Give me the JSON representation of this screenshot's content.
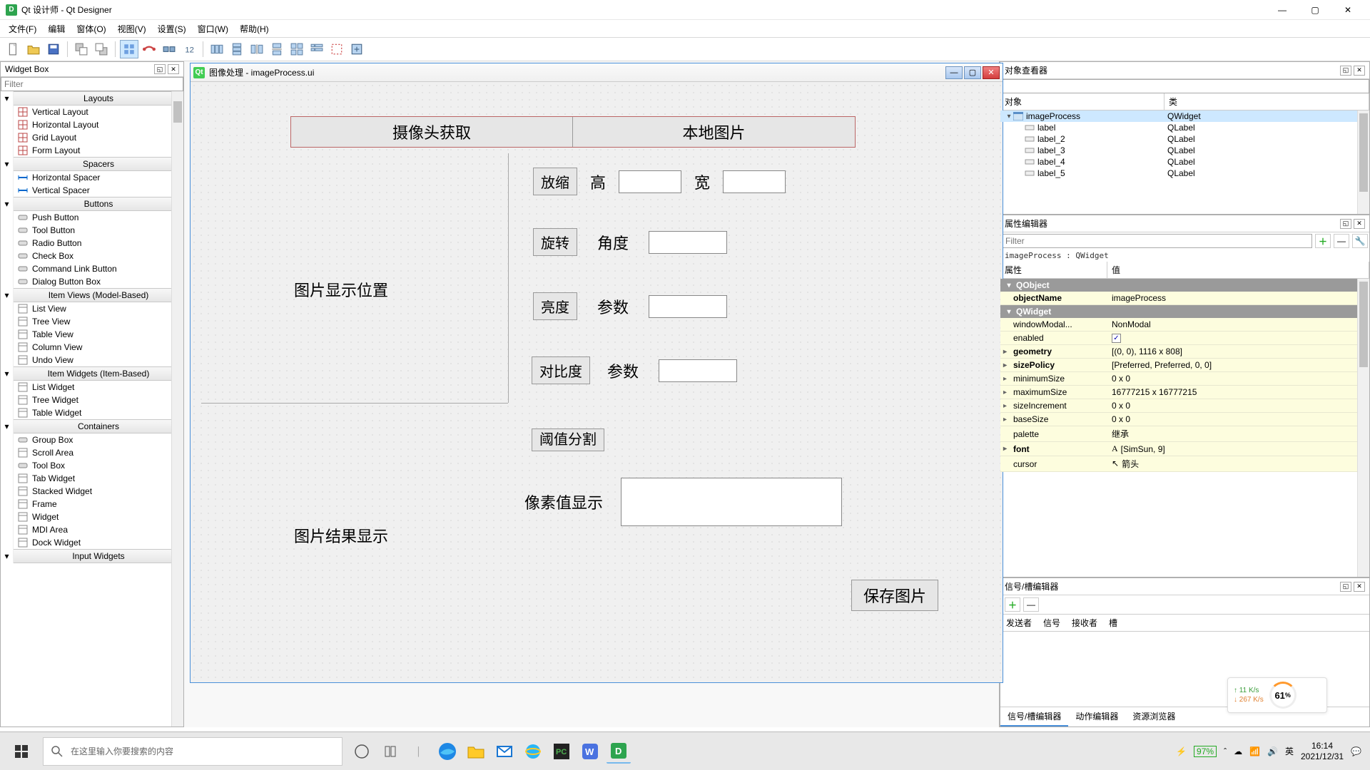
{
  "titlebar": {
    "app_title": "Qt 设计师 - Qt Designer",
    "appicon_letter": "D"
  },
  "menubar": {
    "items": [
      "文件(F)",
      "编辑",
      "窗体(O)",
      "视图(V)",
      "设置(S)",
      "窗口(W)",
      "帮助(H)"
    ]
  },
  "widgetbox": {
    "title": "Widget Box",
    "filter_placeholder": "Filter",
    "categories": [
      {
        "name": "Layouts",
        "items": [
          "Vertical Layout",
          "Horizontal Layout",
          "Grid Layout",
          "Form Layout"
        ]
      },
      {
        "name": "Spacers",
        "items": [
          "Horizontal Spacer",
          "Vertical Spacer"
        ]
      },
      {
        "name": "Buttons",
        "items": [
          "Push Button",
          "Tool Button",
          "Radio Button",
          "Check Box",
          "Command Link Button",
          "Dialog Button Box"
        ]
      },
      {
        "name": "Item Views (Model-Based)",
        "items": [
          "List View",
          "Tree View",
          "Table View",
          "Column View",
          "Undo View"
        ]
      },
      {
        "name": "Item Widgets (Item-Based)",
        "items": [
          "List Widget",
          "Tree Widget",
          "Table Widget"
        ]
      },
      {
        "name": "Containers",
        "items": [
          "Group Box",
          "Scroll Area",
          "Tool Box",
          "Tab Widget",
          "Stacked Widget",
          "Frame",
          "Widget",
          "MDI Area",
          "Dock Widget"
        ]
      },
      {
        "name": "Input Widgets",
        "items": []
      }
    ]
  },
  "designer_window": {
    "title": "图像处理 - imageProcess.ui",
    "tabcam": "摄像头获取",
    "tablocal": "本地图片",
    "img_display": "图片显示位置",
    "img_result": "图片结果显示",
    "zoom": "放缩",
    "height_lbl": "高",
    "width_lbl": "宽",
    "rotate": "旋转",
    "angle_lbl": "角度",
    "brightness": "亮度",
    "param_lbl": "参数",
    "contrast": "对比度",
    "threshold": "阈值分割",
    "pixelval": "像素值显示",
    "save": "保存图片"
  },
  "object_inspector": {
    "title": "对象查看器",
    "col_object": "对象",
    "col_class": "类",
    "rows": [
      {
        "name": "imageProcess",
        "cls": "QWidget",
        "root": true
      },
      {
        "name": "label",
        "cls": "QLabel"
      },
      {
        "name": "label_2",
        "cls": "QLabel"
      },
      {
        "name": "label_3",
        "cls": "QLabel"
      },
      {
        "name": "label_4",
        "cls": "QLabel"
      },
      {
        "name": "label_5",
        "cls": "QLabel"
      }
    ]
  },
  "property_editor": {
    "title": "属性编辑器",
    "filter_placeholder": "Filter",
    "context": "imageProcess : QWidget",
    "col_prop": "属性",
    "col_val": "值",
    "groups": [
      {
        "name": "QObject",
        "rows": [
          {
            "k": "objectName",
            "v": "imageProcess",
            "bold": true
          }
        ]
      },
      {
        "name": "QWidget",
        "rows": [
          {
            "k": "windowModal...",
            "v": "NonModal"
          },
          {
            "k": "enabled",
            "v": "",
            "checkbox": true,
            "checked": true
          },
          {
            "k": "geometry",
            "v": "[(0, 0), 1116 x 808]",
            "bold": true,
            "expand": true
          },
          {
            "k": "sizePolicy",
            "v": "[Preferred, Preferred, 0, 0]",
            "bold": true,
            "expand": true
          },
          {
            "k": "minimumSize",
            "v": "0 x 0",
            "expand": true
          },
          {
            "k": "maximumSize",
            "v": "16777215 x 16777215",
            "expand": true
          },
          {
            "k": "sizeIncrement",
            "v": "0 x 0",
            "expand": true
          },
          {
            "k": "baseSize",
            "v": "0 x 0",
            "expand": true
          },
          {
            "k": "palette",
            "v": "继承"
          },
          {
            "k": "font",
            "v": "[SimSun, 9]",
            "bold": true,
            "expand": true,
            "icon": "A"
          },
          {
            "k": "cursor",
            "v": "箭头",
            "icon": "↖"
          }
        ]
      }
    ]
  },
  "signal_editor": {
    "title": "信号/槽编辑器",
    "cols": [
      "发送者",
      "信号",
      "接收者",
      "槽"
    ],
    "tabs": [
      "信号/槽编辑器",
      "动作编辑器",
      "资源浏览器"
    ]
  },
  "netwidget": {
    "up": "↑ 11  K/s",
    "down": "↓ 267 K/s",
    "percent": "61",
    "unit": "%"
  },
  "taskbar": {
    "search_placeholder": "在这里输入你要搜索的内容",
    "battery": "97%",
    "ime": "英",
    "time": "16:14",
    "date": "2021/12/31"
  }
}
